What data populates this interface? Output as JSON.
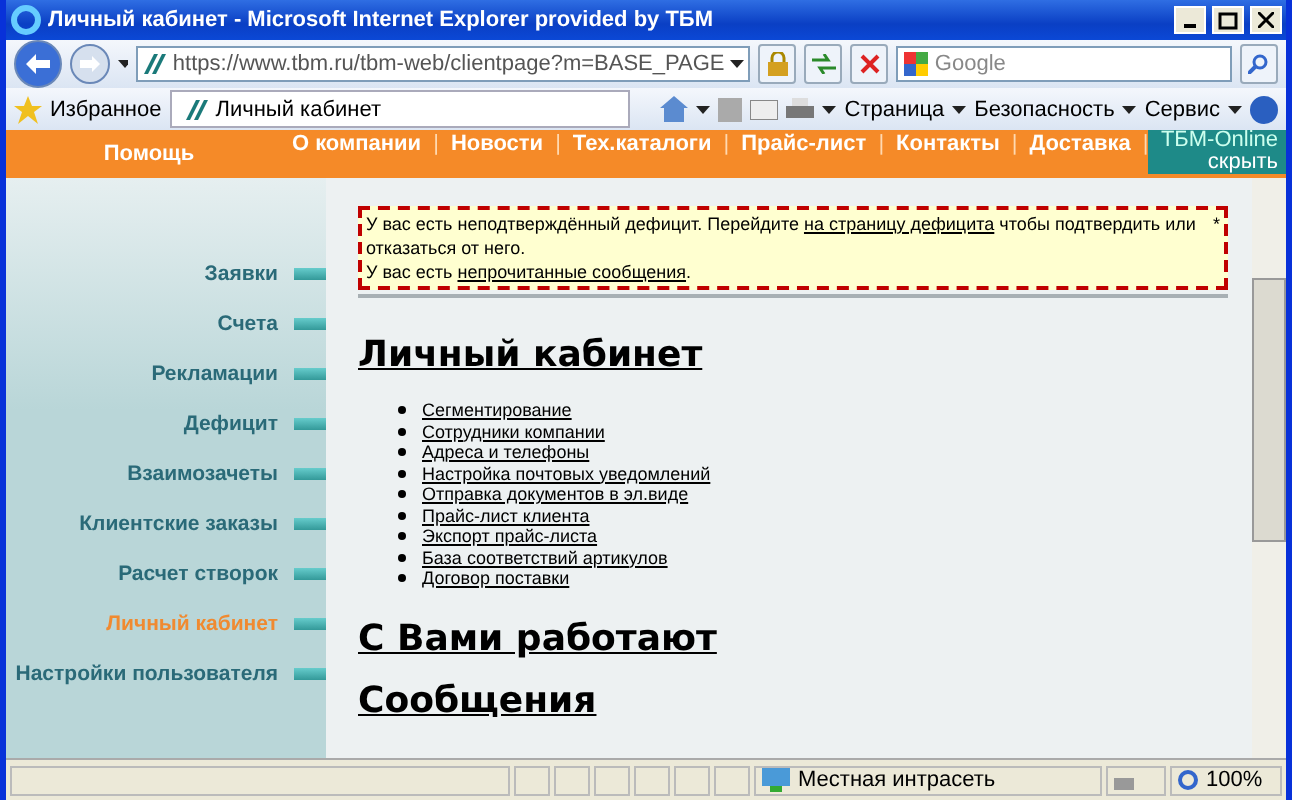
{
  "window": {
    "title": "Личный кабинет - Microsoft Internet Explorer provided by ТБМ"
  },
  "address": {
    "url": "https://www.tbm.ru/tbm-web/clientpage?m=BASE_PAGE"
  },
  "search": {
    "placeholder": "Google"
  },
  "favorites": {
    "label": "Избранное"
  },
  "tab": {
    "label": "Личный кабинет",
    "selected": true
  },
  "commands": [
    {
      "label": "Страница"
    },
    {
      "label": "Безопасность"
    },
    {
      "label": "Сервис"
    }
  ],
  "site_nav": {
    "help": "Помощь",
    "items": [
      "О компании",
      "Новости",
      "Тех.каталоги",
      "Прайс-лист",
      "Контакты",
      "Доставка"
    ],
    "separator": "|",
    "online": "ТБМ-Online",
    "hide": "скрыть"
  },
  "sidebar": {
    "items": [
      {
        "label": "Заявки",
        "selected": false
      },
      {
        "label": "Счета",
        "selected": false
      },
      {
        "label": "Рекламации",
        "selected": false
      },
      {
        "label": "Дефицит",
        "selected": false
      },
      {
        "label": "Взаимозачеты",
        "selected": false
      },
      {
        "label": "Клиентские заказы",
        "selected": false
      },
      {
        "label": "Расчет створок",
        "selected": false
      },
      {
        "label": "Личный кабинет",
        "selected": true
      },
      {
        "label": "Настройки пользователя",
        "selected": false
      }
    ]
  },
  "notice": {
    "marker": "*",
    "lines": [
      [
        {
          "text": "У вас есть неподтверждённый дефицит. Перейдите "
        },
        {
          "text": "на страницу дефицита",
          "link": true
        },
        {
          "text": " чтобы подтвердить или отказаться от него."
        }
      ],
      [
        {
          "text": "У вас есть "
        },
        {
          "text": "непрочитанные сообщения",
          "link": true
        },
        {
          "text": "."
        }
      ]
    ]
  },
  "headings": [
    "Личный кабинет",
    "С Вами работают",
    "Сообщения"
  ],
  "links": [
    "Сегментирование",
    "Сотрудники компании",
    "Адреса и телефоны",
    "Настройка почтовых уведомлений",
    "Отправка документов в эл.виде",
    "Прайс-лист клиента",
    "Экспорт прайс-листа",
    "База соответствий артикулов",
    "Договор поставки"
  ],
  "status_bar": {
    "zone": "Местная интрасеть",
    "zoom": "100%"
  }
}
